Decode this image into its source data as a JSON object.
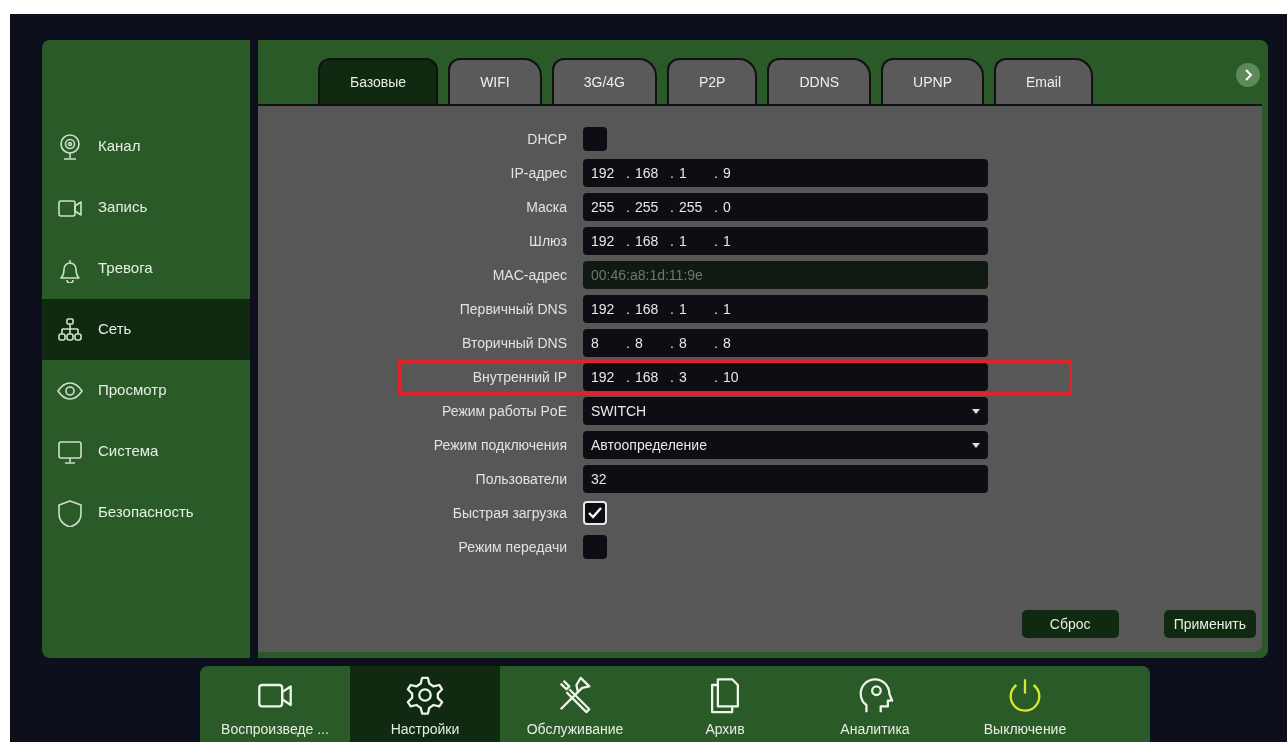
{
  "tabs": [
    {
      "label": "Базовые",
      "selected": true
    },
    {
      "label": "WIFI",
      "selected": false
    },
    {
      "label": "3G/4G",
      "selected": false
    },
    {
      "label": "P2P",
      "selected": false
    },
    {
      "label": "DDNS",
      "selected": false
    },
    {
      "label": "UPNP",
      "selected": false
    },
    {
      "label": "Email",
      "selected": false
    }
  ],
  "sidebar": {
    "items": [
      {
        "label": "Канал",
        "selected": false
      },
      {
        "label": "Запись",
        "selected": false
      },
      {
        "label": "Тревога",
        "selected": false
      },
      {
        "label": "Сеть",
        "selected": true
      },
      {
        "label": "Просмотр",
        "selected": false
      },
      {
        "label": "Система",
        "selected": false
      },
      {
        "label": "Безопасность",
        "selected": false
      }
    ]
  },
  "form": {
    "rows": [
      {
        "label": "DHCP",
        "kind": "checkbox",
        "checked": false,
        "highlighted": false
      },
      {
        "label": "IP-адрес",
        "kind": "ip",
        "octets": [
          "192",
          "168",
          "1",
          "9"
        ],
        "separator": ".",
        "highlighted": false
      },
      {
        "label": "Маска",
        "kind": "ip",
        "octets": [
          "255",
          "255",
          "255",
          "0"
        ],
        "separator": ".",
        "highlighted": false
      },
      {
        "label": "Шлюз",
        "kind": "ip",
        "octets": [
          "192",
          "168",
          "1",
          "1"
        ],
        "separator": ".",
        "highlighted": false
      },
      {
        "label": "MAC-адрес",
        "kind": "text",
        "value": "00:46:a8:1d:11:9e",
        "disabled": true,
        "highlighted": false
      },
      {
        "label": "Первичный DNS",
        "kind": "ip",
        "octets": [
          "192",
          "168",
          "1",
          "1"
        ],
        "separator": ".",
        "highlighted": false
      },
      {
        "label": "Вторичный DNS",
        "kind": "ip",
        "octets": [
          "8",
          "8",
          "8",
          "8"
        ],
        "separator": ".",
        "highlighted": false
      },
      {
        "label": "Внутренний IP",
        "kind": "ip",
        "octets": [
          "192",
          "168",
          "3",
          "10"
        ],
        "separator": ".",
        "highlighted": true
      },
      {
        "label": "Режим работы PoE",
        "kind": "select",
        "value": "SWITCH",
        "highlighted": false
      },
      {
        "label": "Режим подключения",
        "kind": "select",
        "value": "Автоопределение",
        "highlighted": false
      },
      {
        "label": "Пользователи",
        "kind": "text",
        "value": "32",
        "disabled": false,
        "highlighted": false
      },
      {
        "label": "Быстрая загрузка",
        "kind": "checkbox",
        "checked": true,
        "highlighted": false
      },
      {
        "label": "Режим передачи",
        "kind": "checkbox",
        "checked": false,
        "highlighted": false
      }
    ]
  },
  "buttons": [
    "Сброс",
    "Применить"
  ],
  "dock": [
    {
      "label": "Воспроизведе ...",
      "selected": false
    },
    {
      "label": "Настройки",
      "selected": true
    },
    {
      "label": "Обслуживание",
      "selected": false
    },
    {
      "label": "Архив",
      "selected": false
    },
    {
      "label": "Аналитика",
      "selected": false
    },
    {
      "label": "Выключение",
      "selected": false
    }
  ]
}
